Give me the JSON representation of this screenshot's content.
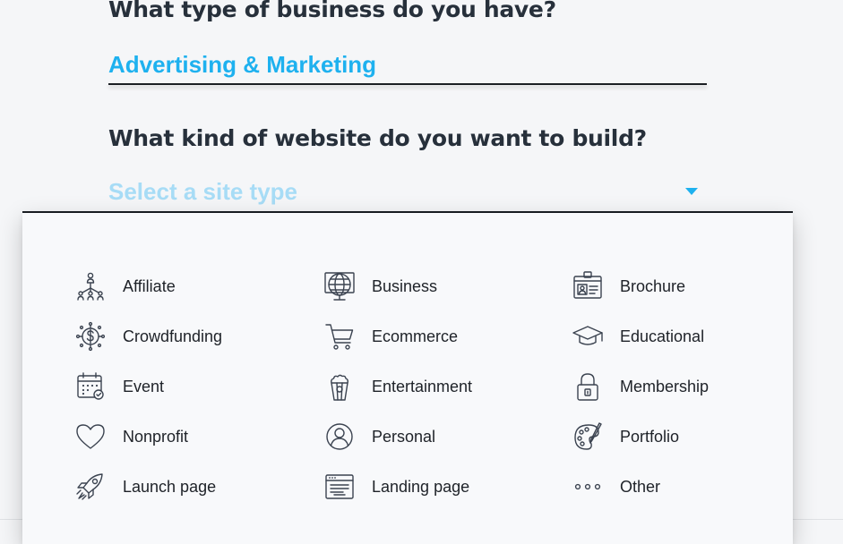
{
  "form": {
    "business_question": "What type of business do you have?",
    "business_value": "Advertising & Marketing",
    "site_question": "What kind of website do you want to build?",
    "site_placeholder": "Select a site type"
  },
  "site_types": [
    {
      "label": "Affiliate",
      "icon": "network-people-icon"
    },
    {
      "label": "Business",
      "icon": "globe-icon"
    },
    {
      "label": "Brochure",
      "icon": "id-card-icon"
    },
    {
      "label": "Crowdfunding",
      "icon": "coin-gear-icon"
    },
    {
      "label": "Ecommerce",
      "icon": "shopping-cart-icon"
    },
    {
      "label": "Educational",
      "icon": "graduation-cap-icon"
    },
    {
      "label": "Event",
      "icon": "calendar-icon"
    },
    {
      "label": "Entertainment",
      "icon": "popcorn-icon"
    },
    {
      "label": "Membership",
      "icon": "padlock-icon"
    },
    {
      "label": "Nonprofit",
      "icon": "heart-icon"
    },
    {
      "label": "Personal",
      "icon": "user-circle-icon"
    },
    {
      "label": "Portfolio",
      "icon": "palette-icon"
    },
    {
      "label": "Launch page",
      "icon": "rocket-icon"
    },
    {
      "label": "Landing page",
      "icon": "browser-window-icon"
    },
    {
      "label": "Other",
      "icon": "dots-icon"
    }
  ],
  "colors": {
    "accent": "#1eb1ef",
    "placeholder": "#a7dcf6",
    "heading": "#27303b",
    "background": "#f5f6f8"
  }
}
